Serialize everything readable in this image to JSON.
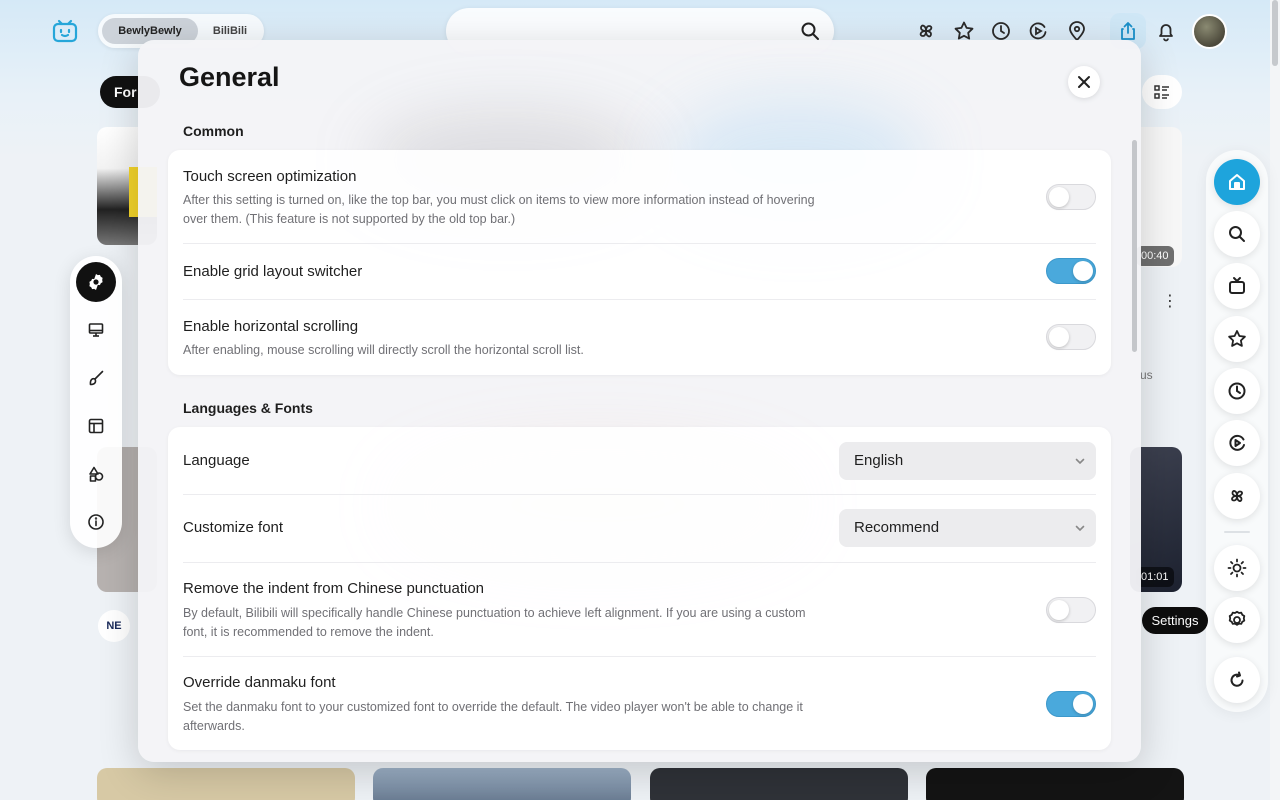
{
  "topbar": {
    "tabs": [
      "BewlyBewly",
      "BiliBili"
    ],
    "icons": [
      "moment-icon",
      "favorite-icon",
      "history-icon",
      "watch-later-icon",
      "location-icon",
      "upload-icon",
      "bell-icon"
    ]
  },
  "feed": {
    "for_you_label": "For",
    "durations": [
      "00:40",
      "01:01"
    ],
    "side_text": "us",
    "channel_logo_text": "NE"
  },
  "settings_nav": {
    "items": [
      "general-icon",
      "desktop-icon",
      "brush-icon",
      "layout-icon",
      "shapes-icon",
      "info-icon"
    ],
    "active_index": 0
  },
  "dock": {
    "items": [
      "home-icon",
      "search-icon",
      "tv-icon",
      "star-icon",
      "clock-icon",
      "watch-later-icon",
      "moment-icon",
      "sun-icon",
      "gear-icon",
      "refresh-icon"
    ],
    "tooltip": "Settings",
    "accent": "#1ea4dc"
  },
  "modal": {
    "title": "General",
    "sections": [
      {
        "title": "Common",
        "rows": [
          {
            "title": "Touch screen optimization",
            "desc": "After this setting is turned on, like the top bar, you must click on items to view more information instead of hovering over them. (This feature is not supported by the old top bar.)",
            "control": "toggle",
            "on": false
          },
          {
            "title": "Enable grid layout switcher",
            "control": "toggle",
            "on": true
          },
          {
            "title": "Enable horizontal scrolling",
            "desc": "After enabling, mouse scrolling will directly scroll the horizontal scroll list.",
            "control": "toggle",
            "on": false
          }
        ]
      },
      {
        "title": "Languages & Fonts",
        "rows": [
          {
            "title": "Language",
            "control": "select",
            "value": "English"
          },
          {
            "title": "Customize font",
            "control": "select",
            "value": "Recommend"
          },
          {
            "title": "Remove the indent from Chinese punctuation",
            "desc": "By default, Bilibili will specifically handle Chinese punctuation to achieve left alignment. If you are using a custom font, it is recommended to remove the indent.",
            "control": "toggle",
            "on": false
          },
          {
            "title": "Override danmaku font",
            "desc": "Set the danmaku font to your customized font to override the default. The video player won't be able to change it afterwards.",
            "control": "toggle",
            "on": true
          }
        ]
      }
    ],
    "toggle_on_color": "#4aa9dc"
  }
}
